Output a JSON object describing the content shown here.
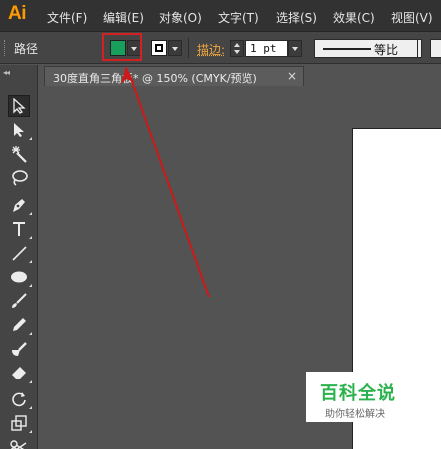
{
  "app": {
    "logo": "Ai"
  },
  "menu": {
    "items": [
      "文件(F)",
      "编辑(E)",
      "对象(O)",
      "文字(T)",
      "选择(S)",
      "效果(C)",
      "视图(V)"
    ]
  },
  "control_bar": {
    "object_type": "路径",
    "fill_color": "#1a9e5b",
    "stroke_label": "描边:",
    "stroke_weight": "1 pt",
    "profile_label": "等比",
    "highlight_color": "#d42020"
  },
  "document": {
    "tab_title": "30度直角三角板* @ 150% (CMYK/预览)",
    "close_glyph": "×"
  },
  "tools": [
    "selection-tool",
    "direct-selection-tool",
    "magic-wand-tool",
    "lasso-tool",
    "pen-tool",
    "type-tool",
    "line-segment-tool",
    "ellipse-tool",
    "paintbrush-tool",
    "pencil-tool",
    "blob-brush-tool",
    "eraser-tool",
    "rotate-tool",
    "scale-tool",
    "scissors-tool"
  ],
  "watermark": {
    "title": "百科全说",
    "subtitle": "助你轻松解决"
  }
}
